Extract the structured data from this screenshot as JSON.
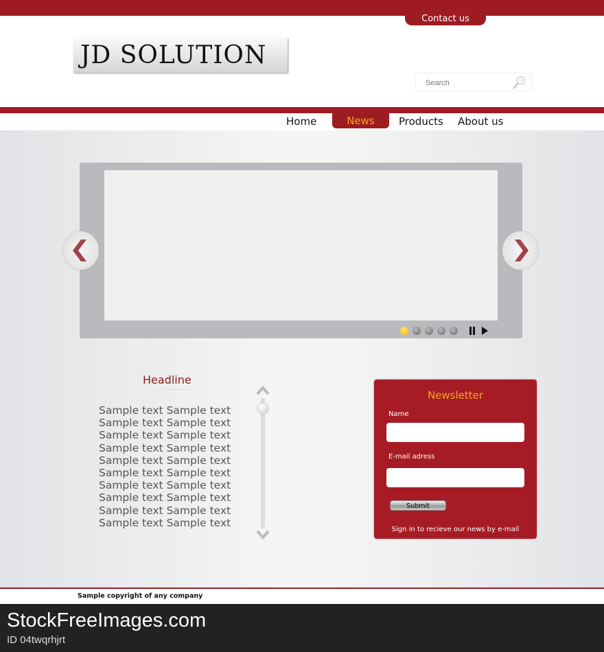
{
  "header": {
    "contact_label": "Contact us",
    "logo_text": "JD SOLUTION",
    "search_placeholder": "Search"
  },
  "nav": {
    "items": [
      {
        "label": "Home"
      },
      {
        "label": "News",
        "active": true
      },
      {
        "label": "Products"
      },
      {
        "label": "About us"
      }
    ]
  },
  "slider": {
    "slide_count": 5,
    "active_slide": 1,
    "controls": [
      "pause-icon",
      "play-icon"
    ],
    "active_dot_color": "#f5c000"
  },
  "article": {
    "headline": "Headline",
    "lines": [
      "Sample text Sample text",
      "Sample text Sample text",
      "Sample text Sample text",
      "Sample text Sample text",
      "Sample text Sample text",
      "Sample text Sample text",
      "Sample text Sample text",
      "Sample text Sample text",
      "Sample text Sample text",
      "Sample text Sample text"
    ]
  },
  "newsletter": {
    "title": "Newsletter",
    "name_label": "Name",
    "email_label": "E-mail adress",
    "submit_label": "Submit",
    "note": "Sign in to recieve our news by e-mail"
  },
  "footer": {
    "copyright": "Sample copyright of any company"
  },
  "watermark": {
    "logo": "StockFreeImages.com",
    "id": "ID 04twqrhjrt"
  },
  "colors": {
    "brand_red": "#9e1b22",
    "accent": "#f5a623"
  }
}
